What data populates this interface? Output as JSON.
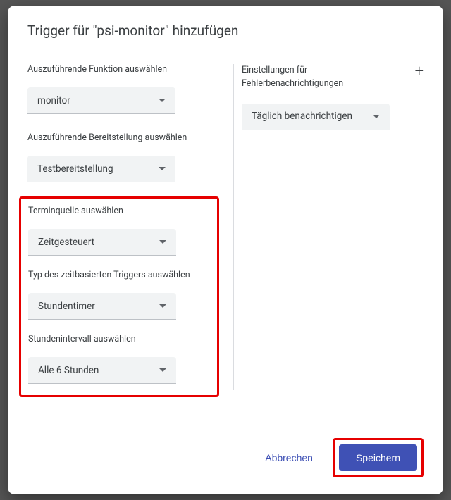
{
  "modal": {
    "title": "Trigger für \"psi-monitor\" hinzufügen"
  },
  "left": {
    "function_label": "Auszuführende Funktion auswählen",
    "function_value": "monitor",
    "deployment_label": "Auszuführende Bereitstellung auswählen",
    "deployment_value": "Testbereitstellung",
    "source_label": "Terminquelle auswählen",
    "source_value": "Zeitgesteuert",
    "type_label": "Typ des zeitbasierten Triggers auswählen",
    "type_value": "Stundentimer",
    "interval_label": "Stundenintervall auswählen",
    "interval_value": "Alle 6 Stunden"
  },
  "right": {
    "notify_label": "Einstellungen für Fehlerbenachrichtigungen",
    "notify_value": "Täglich benachrichtigen"
  },
  "footer": {
    "cancel": "Abbrechen",
    "save": "Speichern"
  }
}
